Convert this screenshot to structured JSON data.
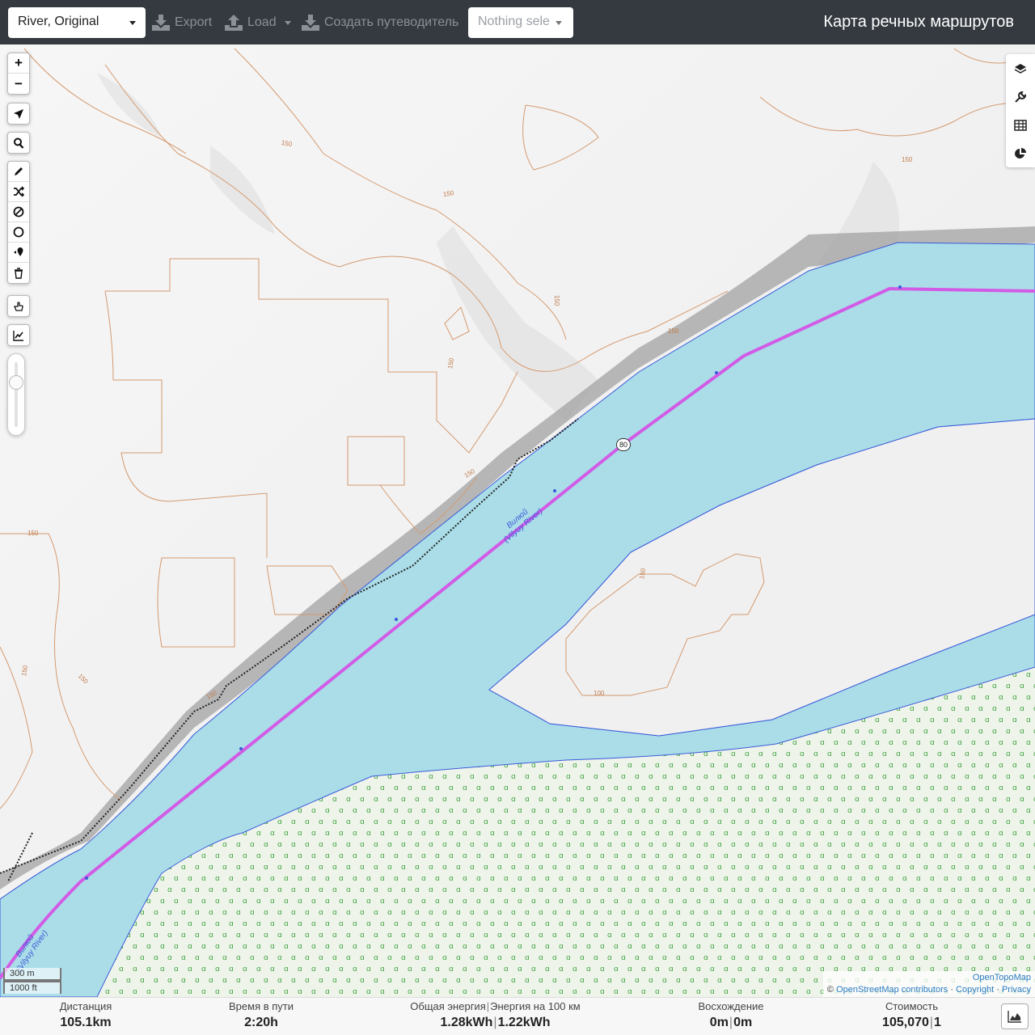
{
  "header": {
    "profile_select": "River, Original",
    "export_label": "Export",
    "load_label": "Load",
    "guide_label": "Создать путеводитель",
    "selection_placeholder": "Nothing sele",
    "app_title": "Карта речных маршрутов"
  },
  "map": {
    "zoom_in": "+",
    "zoom_out": "−",
    "river_label_1": "Вилюй",
    "river_label_1b": "(Vilyuy River)",
    "river_label_2": "Вилюй",
    "river_label_2b": "(Vilyuy River)",
    "route_marker": "80",
    "contour_labels": [
      "150",
      "150",
      "150",
      "150",
      "150",
      "150",
      "150",
      "150",
      "150",
      "150",
      "150",
      "150",
      "100"
    ],
    "scale_metric": "300 m",
    "scale_imperial": "1000 ft",
    "attribution": {
      "topo": "OpenTopoMap",
      "prefix": "©",
      "osm": "OpenStreetMap contributors",
      "separator": "·",
      "copyright": "Copyright",
      "privacy": "Privacy"
    },
    "colors": {
      "water": "#aadde8",
      "route": "#d25be6",
      "forest": "#ebf3e6",
      "contour": "#d59a6f"
    },
    "icons": [
      "layers-icon",
      "wrench-icon",
      "table-icon",
      "pie-chart-icon",
      "locate-icon",
      "search-icon",
      "pencil-icon",
      "shuffle-icon",
      "ban-icon",
      "circle-icon",
      "marker-icon",
      "trash-icon",
      "hand-icon",
      "elevation-chart-icon"
    ]
  },
  "stats": {
    "distance_label": "Дистанция",
    "distance_value": "105.1",
    "distance_unit": "km",
    "time_label": "Время в пути",
    "time_value": "2:20",
    "time_unit": "h",
    "energy_label": "Общая энергия",
    "energy_label2": "Энергия на 100 км",
    "energy_value": "1.28",
    "energy_unit": "kWh",
    "energy100_value": "1.22",
    "energy100_unit": "kWh",
    "ascent_label": "Восхождение",
    "ascent_value": "0",
    "ascent_unit": "m",
    "descent_value": "0",
    "descent_unit": "m",
    "cost_label": "Стоимость",
    "cost_value": "105,070",
    "cost_value2": "1"
  }
}
